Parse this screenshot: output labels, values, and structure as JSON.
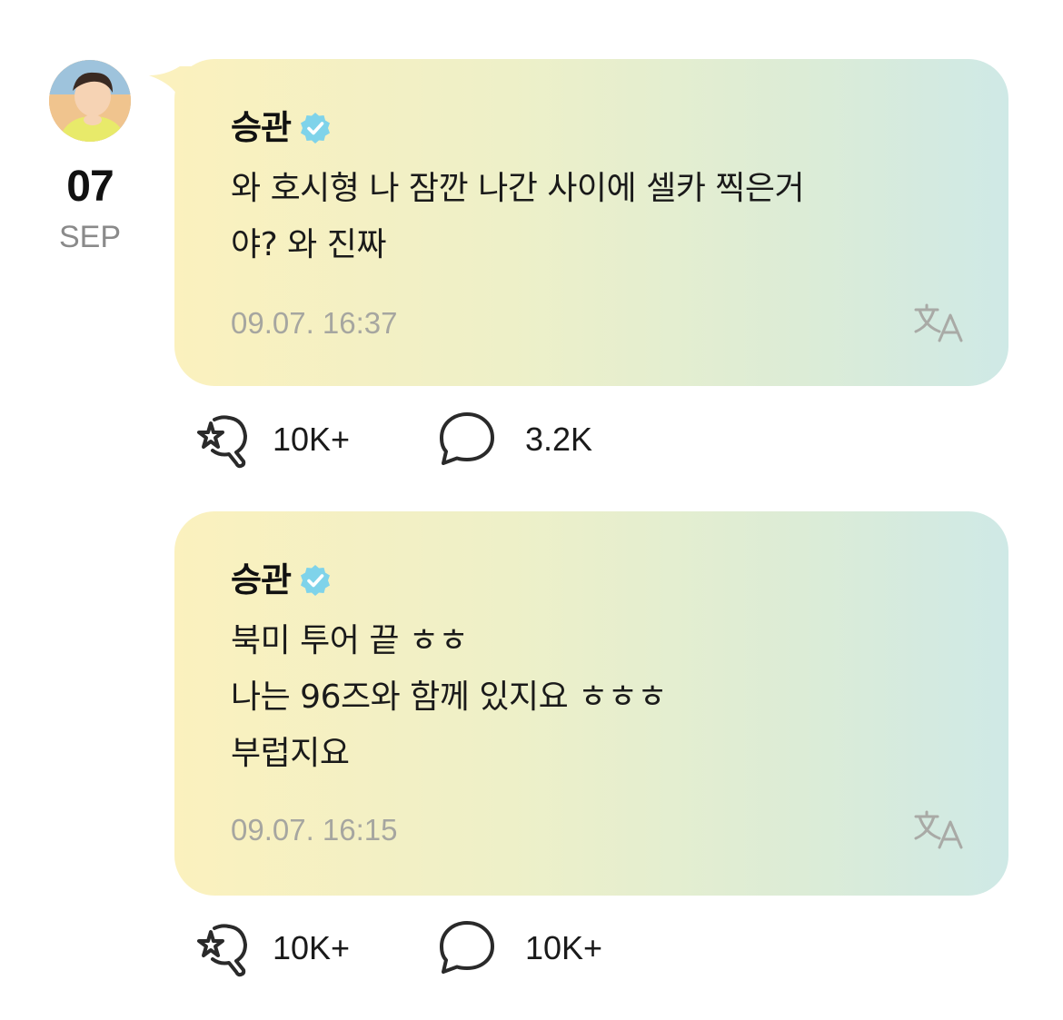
{
  "date": {
    "day": "07",
    "month": "SEP"
  },
  "posts": [
    {
      "author": "승관",
      "lines": [
        "와 호시형 나 잠깐 나간 사이에 셀카 찍은거",
        "야? 와 진짜"
      ],
      "timestamp": "09.07. 16:37",
      "likes": "10K+",
      "comments": "3.2K"
    },
    {
      "author": "승관",
      "lines": [
        "북미 투어 끝 ㅎㅎ",
        "나는 96즈와 함께 있지요 ㅎㅎㅎ",
        "부럽지요"
      ],
      "timestamp": "09.07. 16:15",
      "likes": "10K+",
      "comments": "10K+"
    }
  ],
  "icons": {
    "verified": "verified-badge-icon",
    "translate": "translate-icon",
    "like": "like-sparkle-icon",
    "comment": "comment-bubble-icon"
  },
  "colors": {
    "verified_badge": "#7fd3ea",
    "bubble_start": "#fbf1be",
    "bubble_end": "#cfe9e6",
    "muted_text": "#a6a6a0"
  }
}
